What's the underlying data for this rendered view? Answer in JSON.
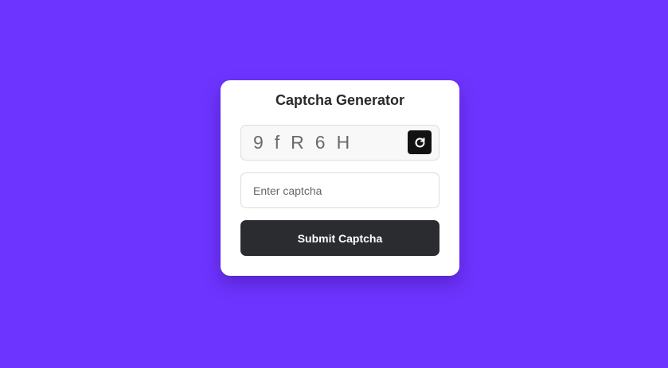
{
  "page": {
    "background_color": "#6e34ff"
  },
  "card": {
    "title": "Captcha Generator",
    "captcha": {
      "text": "9fR6H",
      "refresh_icon": "refresh-icon"
    },
    "input": {
      "value": "",
      "placeholder": "Enter captcha"
    },
    "submit": {
      "label": "Submit Captcha",
      "color": "#2b2c30"
    }
  }
}
